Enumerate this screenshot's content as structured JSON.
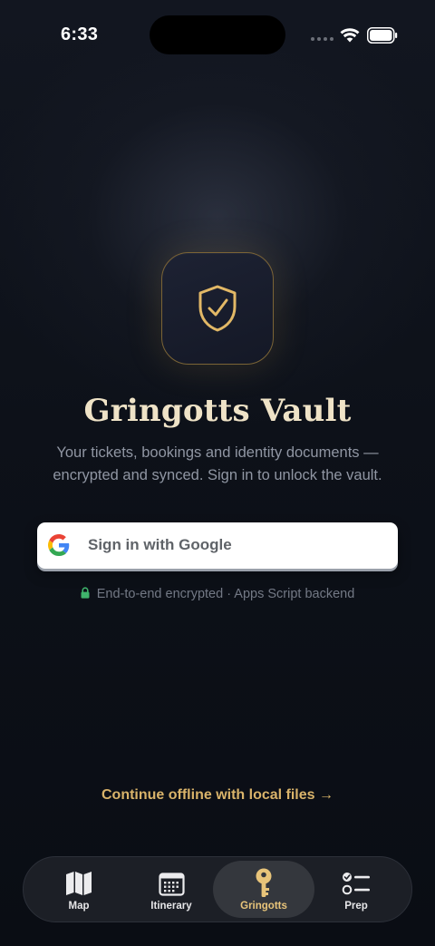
{
  "status_bar": {
    "time": "6:33"
  },
  "app": {
    "title": "Gringotts Vault",
    "subtitle": "Your tickets, bookings and identity documents — encrypted and synced. Sign in to unlock the vault.",
    "icon": "shield-check-icon"
  },
  "sign_in": {
    "google_label": "Sign in with Google",
    "icon": "google-g-icon"
  },
  "security_note": {
    "text": "End-to-end encrypted · Apps Script backend",
    "icon": "lock-icon",
    "icon_color": "#3fb36b"
  },
  "offline": {
    "label": "Continue offline with local files →"
  },
  "colors": {
    "accent_gold": "#e8c47a",
    "link_gold": "#d9b36a",
    "title": "#efe3c7"
  },
  "tabs": [
    {
      "label": "Map",
      "icon": "map-icon",
      "active": false
    },
    {
      "label": "Itinerary",
      "icon": "calendar-icon",
      "active": false
    },
    {
      "label": "Gringotts",
      "icon": "key-icon",
      "active": true
    },
    {
      "label": "Prep",
      "icon": "checklist-icon",
      "active": false
    }
  ]
}
